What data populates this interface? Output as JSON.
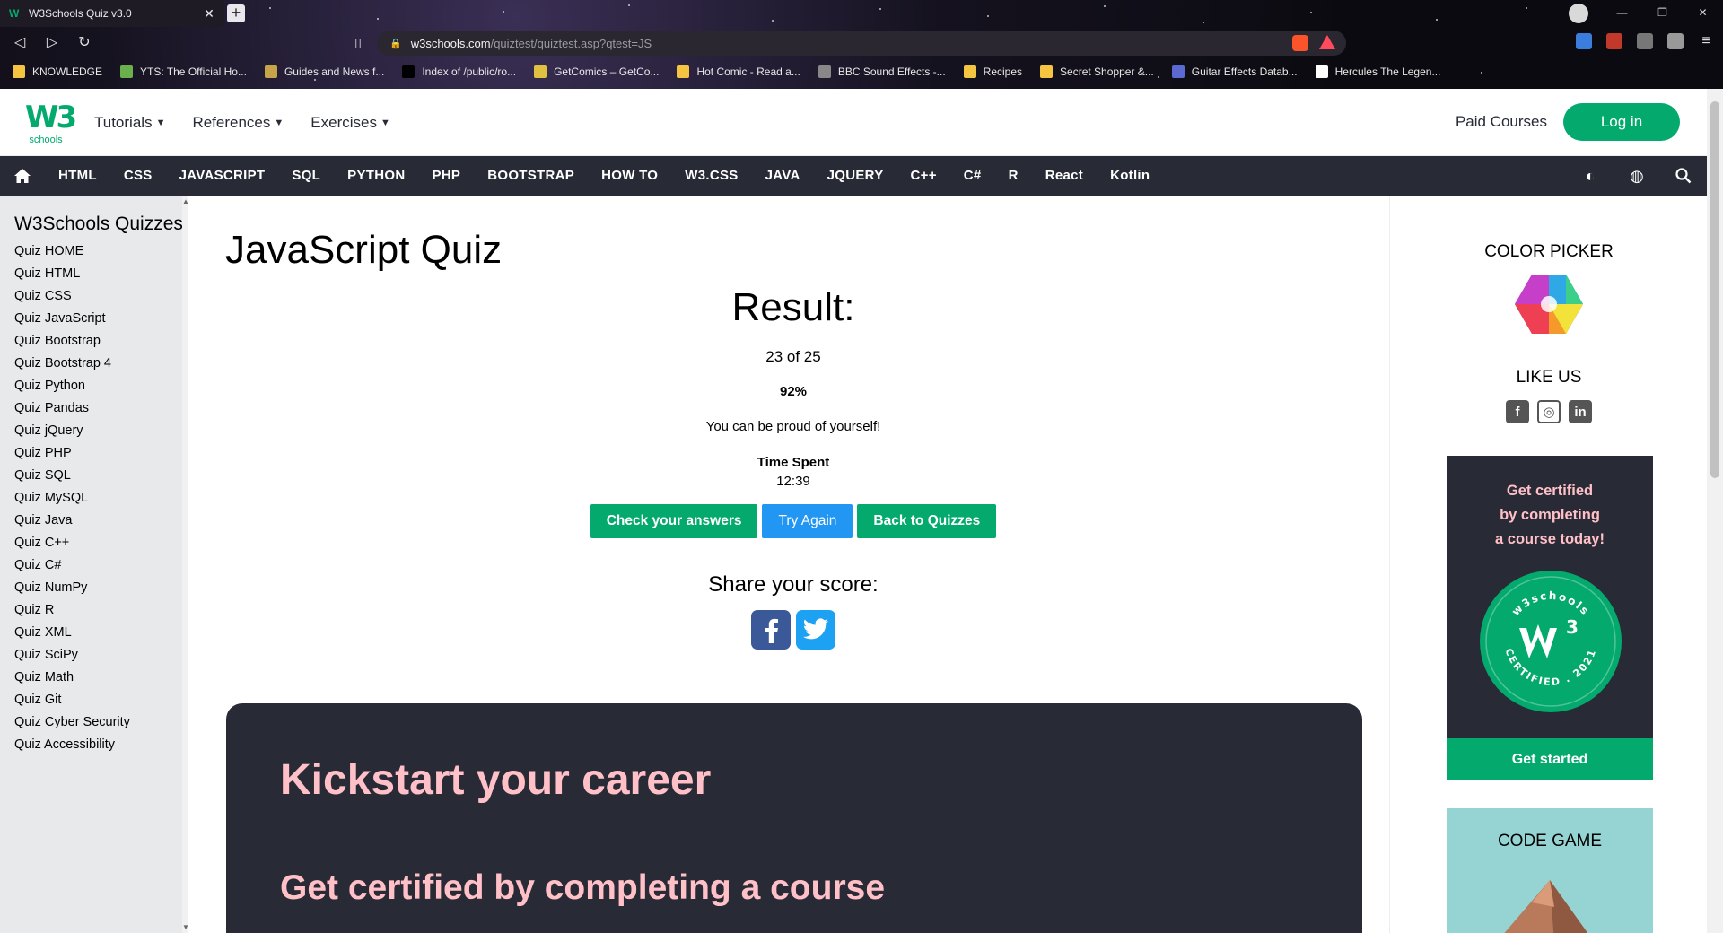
{
  "browser": {
    "tab_title": "W3Schools Quiz v3.0",
    "url_host": "w3schools.com",
    "url_path": "/quiztest/quiztest.asp?qtest=JS",
    "bookmarks": [
      {
        "label": "KNOWLEDGE",
        "color": "#f5c542"
      },
      {
        "label": "YTS: The Official Ho...",
        "color": "#6ab04c"
      },
      {
        "label": "Guides and News f...",
        "color": "#c7a44a"
      },
      {
        "label": "Index of /public/ro...",
        "color": "#000000"
      },
      {
        "label": "GetComics – GetCo...",
        "color": "#e0c040"
      },
      {
        "label": "Hot Comic - Read a...",
        "color": "#f5c542"
      },
      {
        "label": "BBC Sound Effects -...",
        "color": "#888888"
      },
      {
        "label": "Recipes",
        "color": "#f5c542"
      },
      {
        "label": "Secret Shopper &...",
        "color": "#f5c542"
      },
      {
        "label": "Guitar Effects Datab...",
        "color": "#5a6ad0"
      },
      {
        "label": "Hercules The Legen...",
        "color": "#ffffff"
      }
    ]
  },
  "header": {
    "logo_text": "W3",
    "logo_sup": "3",
    "logo_sub": "schools",
    "menu": [
      {
        "label": "Tutorials"
      },
      {
        "label": "References"
      },
      {
        "label": "Exercises"
      }
    ],
    "paid_courses": "Paid Courses",
    "login": "Log in"
  },
  "subnav": [
    "HTML",
    "CSS",
    "JAVASCRIPT",
    "SQL",
    "PYTHON",
    "PHP",
    "BOOTSTRAP",
    "HOW TO",
    "W3.CSS",
    "JAVA",
    "JQUERY",
    "C++",
    "C#",
    "R",
    "React",
    "Kotlin"
  ],
  "sidebar": {
    "title": "W3Schools Quizzes",
    "items": [
      "Quiz HOME",
      "Quiz HTML",
      "Quiz CSS",
      "Quiz JavaScript",
      "Quiz Bootstrap",
      "Quiz Bootstrap 4",
      "Quiz Python",
      "Quiz Pandas",
      "Quiz jQuery",
      "Quiz PHP",
      "Quiz SQL",
      "Quiz MySQL",
      "Quiz Java",
      "Quiz C++",
      "Quiz C#",
      "Quiz NumPy",
      "Quiz R",
      "Quiz XML",
      "Quiz SciPy",
      "Quiz Math",
      "Quiz Git",
      "Quiz Cyber Security",
      "Quiz Accessibility"
    ]
  },
  "main": {
    "title": "JavaScript Quiz",
    "result_heading": "Result:",
    "score": "23 of 25",
    "percent": "92%",
    "message": "You can be proud of yourself!",
    "time_label": "Time Spent",
    "time_value": "12:39",
    "buttons": {
      "check": "Check your answers",
      "try_again": "Try Again",
      "back": "Back to Quizzes"
    },
    "share_heading": "Share your score:",
    "career_title": "Kickstart your career",
    "career_sub": "Get certified by completing a course"
  },
  "right": {
    "color_picker": "COLOR PICKER",
    "like_us": "LIKE US",
    "cert_text_1": "Get certified",
    "cert_text_2": "by completing",
    "cert_text_3": "a course today!",
    "badge_top": "w3schools",
    "badge_bottom": "CERTIFIED . 2021",
    "get_started": "Get started",
    "code_game": "CODE GAME"
  },
  "colors": {
    "brand_green": "#04aa6d",
    "dark": "#282a35",
    "pink": "#ffc0c7",
    "blue": "#2196f3"
  }
}
